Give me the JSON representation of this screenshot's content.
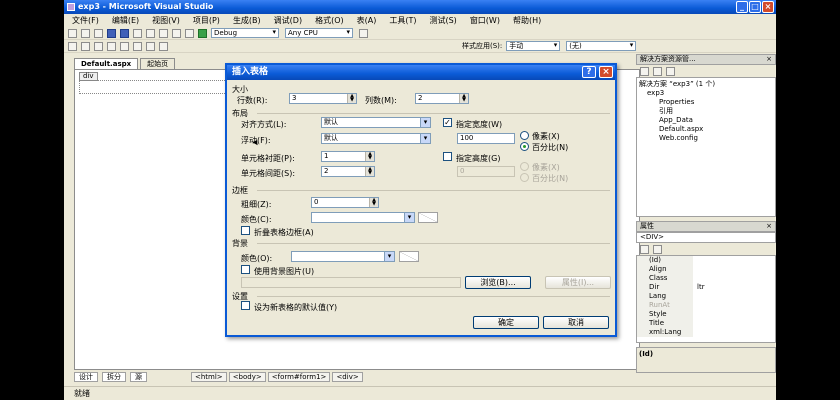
{
  "window": {
    "title": "exp3 - Microsoft Visual Studio"
  },
  "menu": [
    "文件(F)",
    "编辑(E)",
    "视图(V)",
    "项目(P)",
    "生成(B)",
    "调试(D)",
    "格式(O)",
    "表(A)",
    "工具(T)",
    "测试(S)",
    "窗口(W)",
    "帮助(H)"
  ],
  "toolbar": {
    "config": "Debug",
    "platform": "Any CPU",
    "style_apply_label": "样式应用(S):",
    "style_apply_value": "手动",
    "style_combo": "(无)"
  },
  "doc_tabs": [
    "Default.aspx",
    "起始页"
  ],
  "editor": {
    "div_tag": "div"
  },
  "bottom": {
    "design": "设计",
    "split": "拆分",
    "source": "源",
    "crumbs": [
      "<html>",
      "<body>",
      "<form#form1>",
      "<div>"
    ]
  },
  "status": "就绪",
  "solution_explorer": {
    "title": "解决方案资源管...",
    "items": [
      "解决方案 “exp3” (1 个)",
      "exp3",
      "Properties",
      "引用",
      "App_Data",
      "Default.aspx",
      "Web.config"
    ]
  },
  "properties": {
    "title": "属性",
    "selected": "<DIV>",
    "rows": [
      {
        "k": "(Id)",
        "v": ""
      },
      {
        "k": "Align",
        "v": ""
      },
      {
        "k": "Class",
        "v": ""
      },
      {
        "k": "Dir",
        "v": "ltr"
      },
      {
        "k": "Lang",
        "v": ""
      },
      {
        "k": "RunAt",
        "v": ""
      },
      {
        "k": "Style",
        "v": ""
      },
      {
        "k": "Title",
        "v": ""
      },
      {
        "k": "xml:Lang",
        "v": ""
      }
    ],
    "desc": "(Id)"
  },
  "dialog": {
    "title": "插入表格",
    "size_section": "大小",
    "rows_label": "行数(R):",
    "rows_value": "3",
    "cols_label": "列数(M):",
    "cols_value": "2",
    "layout_section": "布局",
    "align_label": "对齐方式(L):",
    "align_value": "默认",
    "float_label": "浮动(F):",
    "float_value": "默认",
    "padding_label": "单元格衬距(P):",
    "padding_value": "1",
    "spacing_label": "单元格间距(S):",
    "spacing_value": "2",
    "width_chk": "指定宽度(W)",
    "width_value": "100",
    "pixels": "像素(X)",
    "percent": "百分比(N)",
    "height_chk": "指定高度(G)",
    "height_value": "0",
    "pixels2": "像素(X)",
    "percent2": "百分比(N)",
    "border_section": "边框",
    "thickness_label": "粗细(Z):",
    "thickness_value": "0",
    "color_label": "颜色(C):",
    "collapse_chk": "折叠表格边框(A)",
    "bg_section": "背景",
    "bg_color_label": "颜色(O):",
    "bg_image_chk": "使用背景图片(U)",
    "browse": "浏览(B)...",
    "attrs": "属性(I)...",
    "settings_section": "设置",
    "default_chk": "设为新表格的默认值(Y)",
    "ok": "确定",
    "cancel": "取消"
  }
}
